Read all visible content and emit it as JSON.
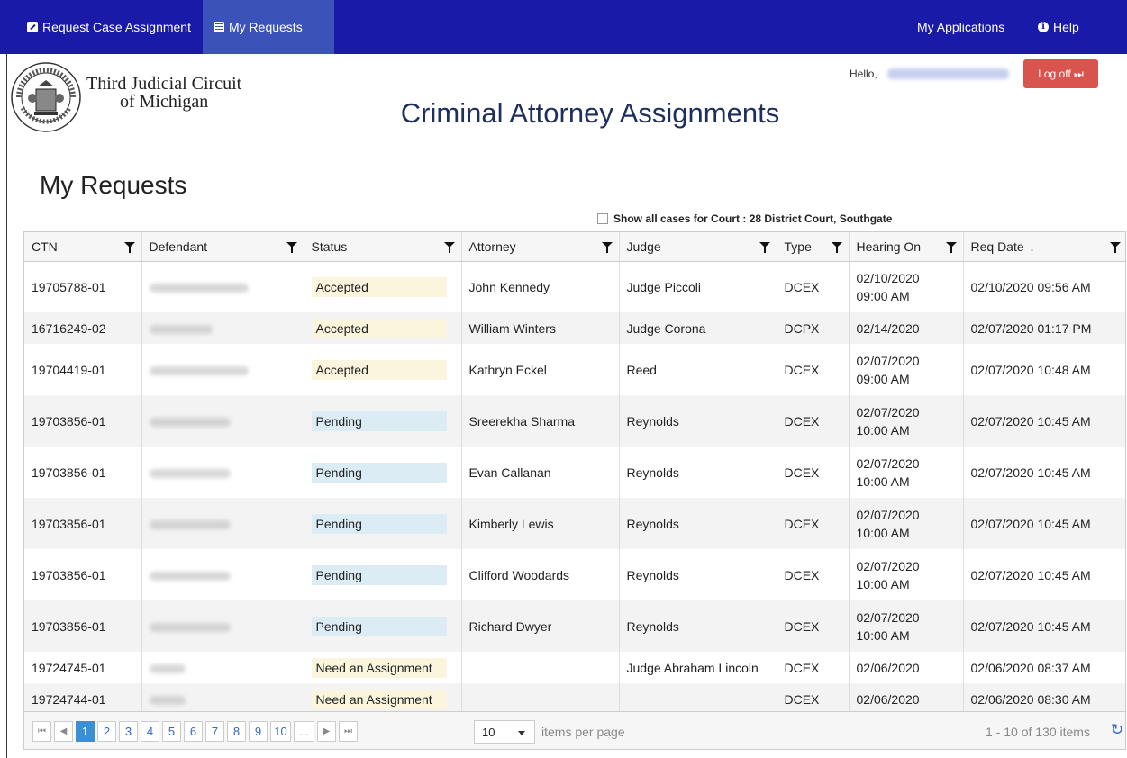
{
  "nav": {
    "request_case": "Request Case Assignment",
    "my_requests": "My Requests",
    "my_applications": "My Applications",
    "help": "Help"
  },
  "header": {
    "court_line1": "Third Judicial Circuit",
    "court_line2": "of Michigan",
    "hello": "Hello,",
    "logoff": "Log off ⏭",
    "app_title": "Criminal Attorney Assignments"
  },
  "page": {
    "title": "My Requests",
    "show_all_label": "Show all cases for Court : 28 District Court, Southgate"
  },
  "colors": {
    "navbar": "#1a1aa8",
    "accepted_bg": "#fcf5dd",
    "pending_bg": "#dcecf5",
    "need_bg": "#fcf5dd",
    "logoff": "#d9534f"
  },
  "grid": {
    "columns": [
      "CTN",
      "Defendant",
      "Status",
      "Attorney",
      "Judge",
      "Type",
      "Hearing On",
      "Req Date"
    ],
    "rows": [
      {
        "ctn": "19705788-01",
        "status": "Accepted",
        "attorney": "John Kennedy",
        "judge": "Judge Piccoli",
        "type": "DCEX",
        "hearing1": "02/10/2020",
        "hearing2": "09:00 AM",
        "req": "02/10/2020 09:56 AM"
      },
      {
        "ctn": "16716249-02",
        "status": "Accepted",
        "attorney": "William Winters",
        "judge": "Judge Corona",
        "type": "DCPX",
        "hearing1": "02/14/2020",
        "hearing2": "",
        "req": "02/07/2020 01:17 PM"
      },
      {
        "ctn": "19704419-01",
        "status": "Accepted",
        "attorney": "Kathryn Eckel",
        "judge": "Reed",
        "type": "DCEX",
        "hearing1": "02/07/2020",
        "hearing2": "09:00 AM",
        "req": "02/07/2020 10:48 AM"
      },
      {
        "ctn": "19703856-01",
        "status": "Pending",
        "attorney": "Sreerekha Sharma",
        "judge": "Reynolds",
        "type": "DCEX",
        "hearing1": "02/07/2020",
        "hearing2": "10:00 AM",
        "req": "02/07/2020 10:45 AM"
      },
      {
        "ctn": "19703856-01",
        "status": "Pending",
        "attorney": "Evan Callanan",
        "judge": "Reynolds",
        "type": "DCEX",
        "hearing1": "02/07/2020",
        "hearing2": "10:00 AM",
        "req": "02/07/2020 10:45 AM"
      },
      {
        "ctn": "19703856-01",
        "status": "Pending",
        "attorney": "Kimberly Lewis",
        "judge": "Reynolds",
        "type": "DCEX",
        "hearing1": "02/07/2020",
        "hearing2": "10:00 AM",
        "req": "02/07/2020 10:45 AM"
      },
      {
        "ctn": "19703856-01",
        "status": "Pending",
        "attorney": "Clifford Woodards",
        "judge": "Reynolds",
        "type": "DCEX",
        "hearing1": "02/07/2020",
        "hearing2": "10:00 AM",
        "req": "02/07/2020 10:45 AM"
      },
      {
        "ctn": "19703856-01",
        "status": "Pending",
        "attorney": "Richard Dwyer",
        "judge": "Reynolds",
        "type": "DCEX",
        "hearing1": "02/07/2020",
        "hearing2": "10:00 AM",
        "req": "02/07/2020 10:45 AM"
      },
      {
        "ctn": "19724745-01",
        "status": "Need an Assignment",
        "attorney": "",
        "judge": "Judge Abraham Lincoln",
        "type": "DCEX",
        "hearing1": "02/06/2020",
        "hearing2": "",
        "req": "02/06/2020 08:37 AM"
      },
      {
        "ctn": "19724744-01",
        "status": "Need an Assignment",
        "attorney": "",
        "judge": "",
        "type": "DCEX",
        "hearing1": "02/06/2020",
        "hearing2": "",
        "req": "02/06/2020 08:30 AM"
      }
    ]
  },
  "pager": {
    "first": "⏮",
    "prev": "◀",
    "pages": [
      "1",
      "2",
      "3",
      "4",
      "5",
      "6",
      "7",
      "8",
      "9",
      "10",
      "..."
    ],
    "current_page": "1",
    "next": "▶",
    "last": "⏭",
    "per_page_value": "10",
    "per_page_label": "items per page",
    "info": "1 - 10 of 130 items",
    "refresh": "↻"
  }
}
